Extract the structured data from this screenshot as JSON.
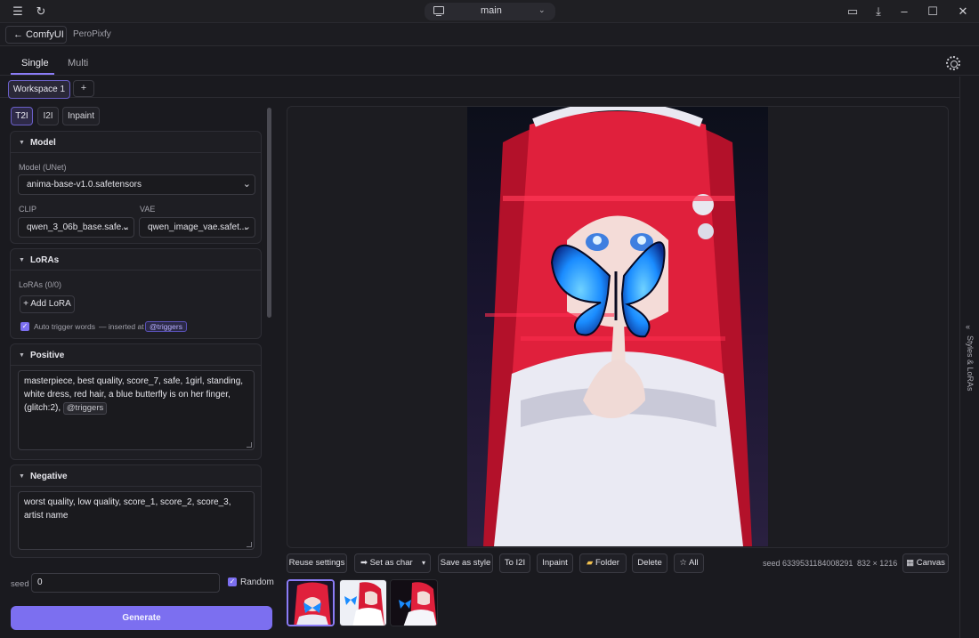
{
  "titlebar": {
    "branch": "main",
    "icons": [
      "menu-icon",
      "refresh-icon",
      "feedback-icon",
      "download-icon",
      "minimize-icon",
      "maximize-icon",
      "close-icon"
    ]
  },
  "nav": {
    "back_label": "← ComfyUI",
    "app_title": "PeroPixfy"
  },
  "mode_tabs": [
    {
      "label": "Single",
      "active": true
    },
    {
      "label": "Multi",
      "active": false
    }
  ],
  "workspace": {
    "tab_label": "Workspace 1",
    "add_label": "+"
  },
  "sub_tabs": [
    {
      "label": "T2I",
      "active": true
    },
    {
      "label": "I2I",
      "active": false
    },
    {
      "label": "Inpaint",
      "active": false
    }
  ],
  "model_card": {
    "title": "Model",
    "unet_label": "Model (UNet)",
    "unet_value": "anima-base-v1.0.safetensors",
    "clip_label": "CLIP",
    "clip_value": "qwen_3_06b_base.safe...",
    "vae_label": "VAE",
    "vae_value": "qwen_image_vae.safet..."
  },
  "lora_card": {
    "title": "LoRAs",
    "count_label": "LoRAs (0/0)",
    "add_label": "+ Add LoRA",
    "auto_trigger_label": "Auto trigger words",
    "inserted_at": "— inserted at",
    "trigger_tag": "@triggers",
    "auto_trigger_checked": true
  },
  "positive": {
    "title": "Positive",
    "text": "masterpiece, best quality, score_7, safe, 1girl, standing, white dress, red hair, a blue butterfly is on her finger, (glitch:2),",
    "trigger_tag": "@triggers"
  },
  "negative": {
    "title": "Negative",
    "text": "worst quality, low quality, score_1, score_2, score_3, artist name"
  },
  "seed": {
    "label": "seed",
    "value": "0",
    "random_label": "Random",
    "random_checked": true
  },
  "generate_label": "Generate",
  "actions": {
    "reuse": "Reuse settings",
    "set_as_char": "➡ Set as char",
    "save_style": "Save as style",
    "to_i2i": "To I2I",
    "inpaint": "Inpaint",
    "folder": "Folder",
    "delete": "Delete",
    "all": "All",
    "canvas": "Canvas"
  },
  "meta": {
    "seed_text": "seed 6339531184008291",
    "size_text": "832 × 1216"
  },
  "right_panel": {
    "label": "Styles & LoRAs",
    "collapse_icon": "«"
  },
  "colors": {
    "accent": "#7c6ff0",
    "background": "#1a1a1f",
    "panel": "#1e1e23",
    "hair": "#e0203c",
    "butterfly": "#1a8cff"
  }
}
